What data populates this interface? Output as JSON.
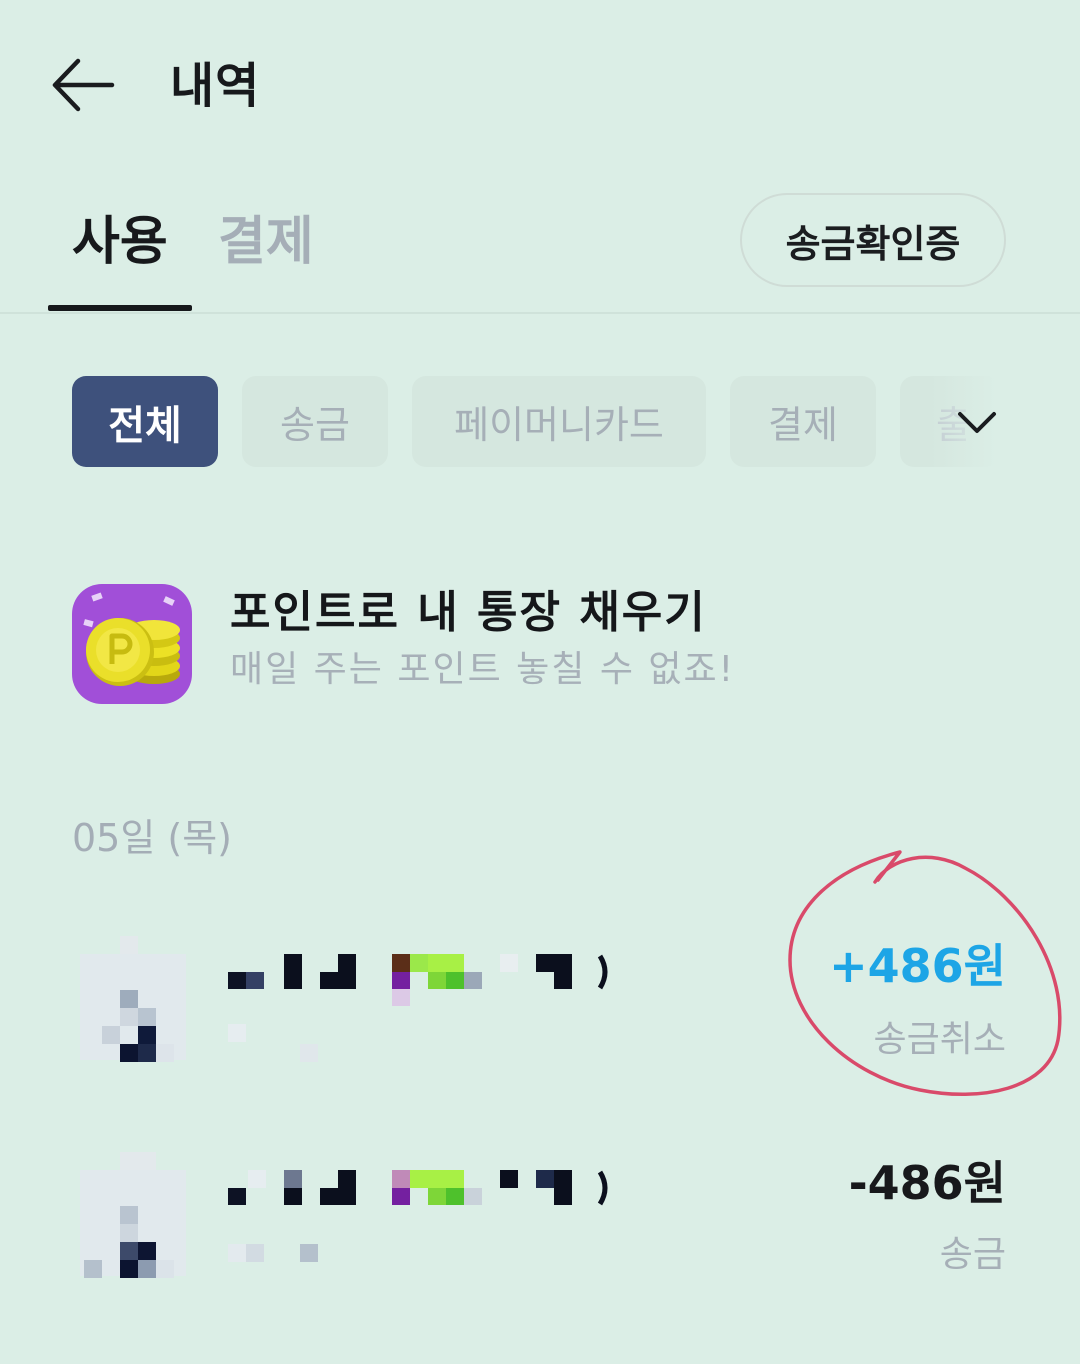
{
  "header": {
    "title": "내역",
    "back_icon": "arrow-left-icon"
  },
  "tabs": [
    {
      "label": "사용",
      "active": true
    },
    {
      "label": "결제",
      "active": false
    }
  ],
  "remit_certificate_button": "송금확인증",
  "filter_chips": [
    {
      "label": "전체",
      "selected": true
    },
    {
      "label": "송금",
      "selected": false
    },
    {
      "label": "페이머니카드",
      "selected": false
    },
    {
      "label": "결제",
      "selected": false
    },
    {
      "label": "출",
      "selected": false
    }
  ],
  "expand_icon": "chevron-down-icon",
  "promo": {
    "title": "포인트로 내 통장 채우기",
    "subtitle": "매일 주는 포인트 놓칠 수 없죠!",
    "icon": "coin-stack-icon"
  },
  "date_header": "05일 (목)",
  "transactions": [
    {
      "amount": "+486원",
      "status": "송금취소",
      "highlighted": true
    },
    {
      "amount": "-486원",
      "status": "송금",
      "highlighted": false
    }
  ],
  "colors": {
    "background": "#dbeee6",
    "chip_selected": "#3e517c",
    "positive_amount": "#1da5e6",
    "annotation": "#d94a6a"
  }
}
